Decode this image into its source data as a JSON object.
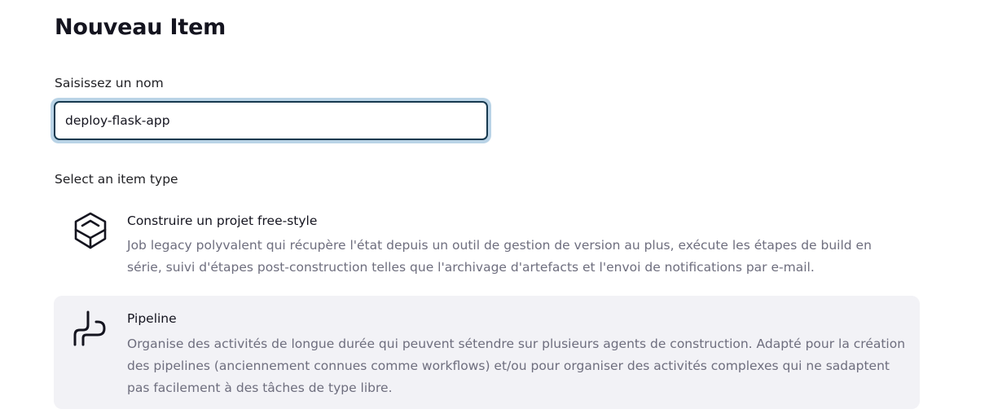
{
  "page": {
    "title": "Nouveau Item"
  },
  "name_field": {
    "label": "Saisissez un nom",
    "value": "deploy-flask-app"
  },
  "item_types": {
    "label": "Select an item type",
    "items": [
      {
        "name": "Construire un projet free-style",
        "icon": "cube-icon",
        "description": "Job legacy polyvalent qui récupère l'état depuis un outil de gestion de version au plus, exécute les étapes de build en série, suivi d'étapes post-construction telles que l'archivage d'artefacts et l'envoi de notifications par e-mail.",
        "selected": false
      },
      {
        "name": "Pipeline",
        "icon": "pipeline-icon",
        "description": "Organise des activités de longue durée qui peuvent sétendre sur plusieurs agents de construction. Adapté pour la création des pipelines (anciennement connues comme workflows) et/ou pour organiser des activités complexes qui ne sadaptent pas facilement à des tâches de type libre.",
        "selected": true
      }
    ]
  },
  "colors": {
    "focus_ring": "#b9d3e6",
    "input_border": "#17394f",
    "hover_background": "#f2f2f6",
    "description_text": "#6e6e7e"
  }
}
